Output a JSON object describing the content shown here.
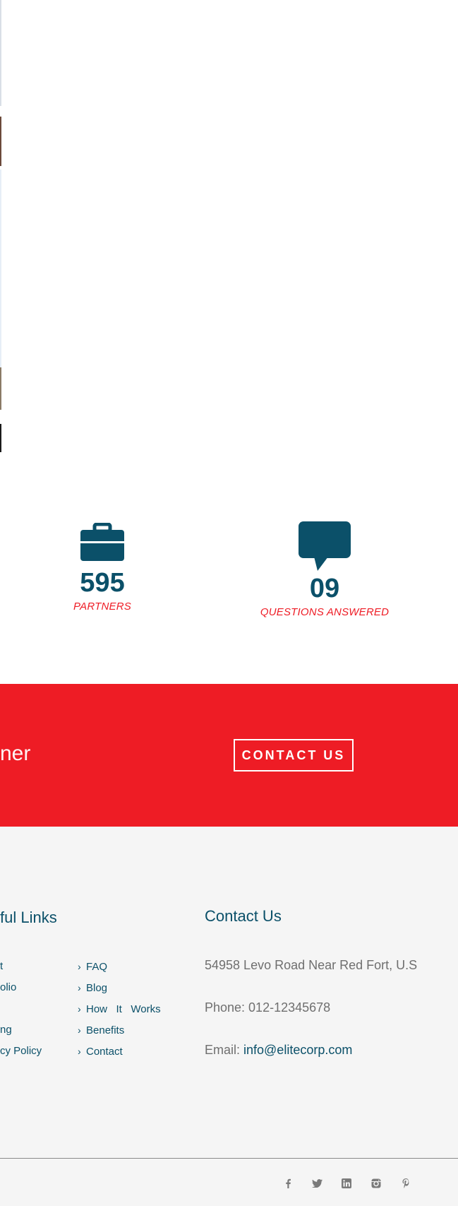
{
  "stats": [
    {
      "icon": "briefcase-icon",
      "number": "595",
      "label": "PARTNERS"
    },
    {
      "icon": "speech-bubble-icon",
      "number": "09",
      "label": "QUESTIONS ANSWERED"
    }
  ],
  "cta": {
    "text": "ner",
    "button_label": "CONTACT US"
  },
  "footer": {
    "useful_links_heading": "ful Links",
    "left_links": [
      "t",
      "olio",
      "",
      "ng",
      "cy Policy"
    ],
    "right_links": [
      "FAQ",
      "Blog",
      "How   It   Works",
      "Benefits",
      "Contact"
    ],
    "contact_heading": "Contact Us",
    "address": "54958 Levo Road Near Red Fort, U.S",
    "phone": "Phone: 012-12345678",
    "email_label": "Email: ",
    "email": "info@elitecorp.com"
  },
  "social_icons": [
    "facebook-icon",
    "twitter-icon",
    "linkedin-icon",
    "instagram-icon",
    "pinterest-icon"
  ],
  "colors": {
    "brand_blue": "#0b5069",
    "accent_red": "#ee1c25",
    "footer_bg": "#f5f5f5"
  }
}
